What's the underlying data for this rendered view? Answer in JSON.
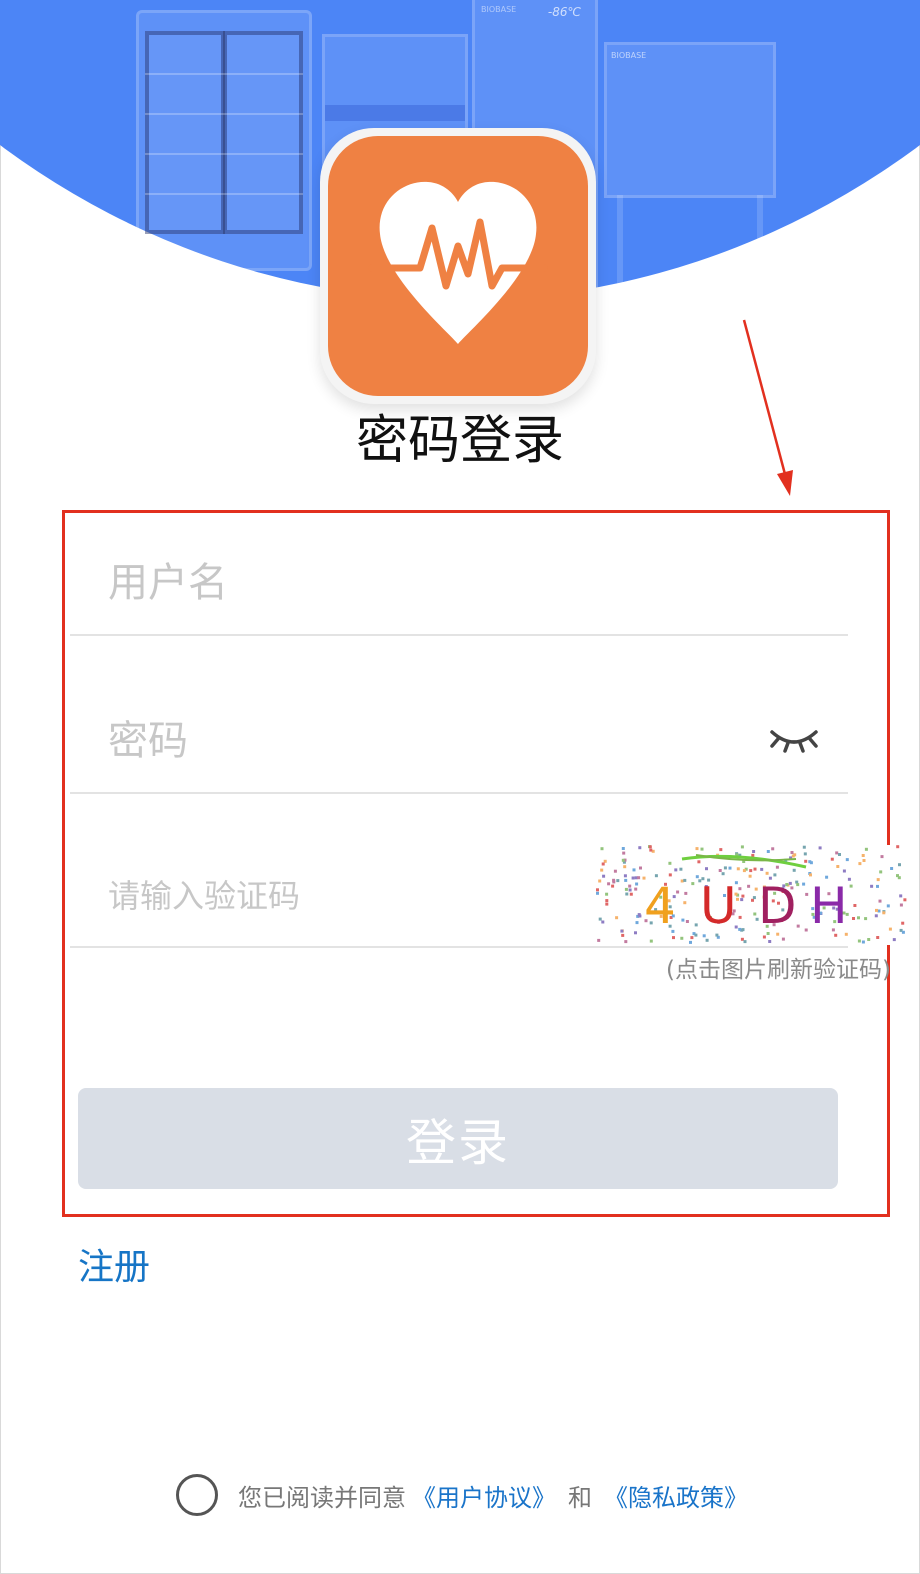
{
  "header": {
    "freezer_temp": "-86℃",
    "freezer_brand": "BIOBASE",
    "bench_brand": "BIOBASE",
    "app_icon": "heart-pulse-icon"
  },
  "title": "密码登录",
  "form": {
    "username_placeholder": "用户名",
    "password_placeholder": "密码",
    "captcha_placeholder": "请输入验证码",
    "captcha_code": "4UDH",
    "captcha_hint": "(点击图片刷新验证码)",
    "login_label": "登录",
    "password_toggle_icon": "eye-closed-icon"
  },
  "register_label": "注册",
  "agreement": {
    "prefix": "您已阅读并同意",
    "user_agreement": "《用户协议》",
    "conjunction": "和",
    "privacy_policy": "《隐私政策》"
  },
  "colors": {
    "header_blue": "#4c85f6",
    "icon_orange": "#ef8143",
    "link_blue": "#1675c6",
    "annotation_red": "#e2301f",
    "disabled_button": "#d9dee6"
  }
}
